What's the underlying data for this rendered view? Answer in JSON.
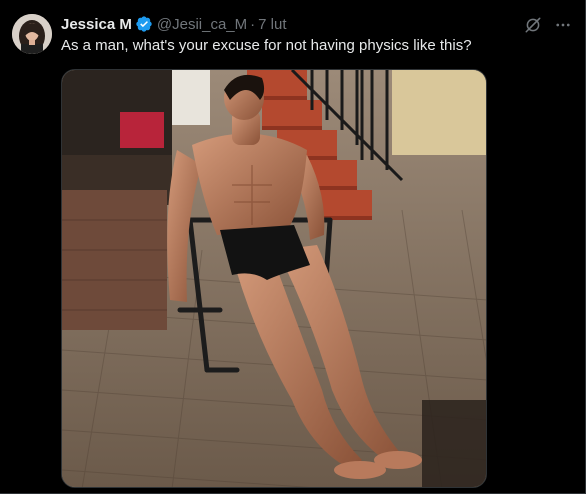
{
  "author": {
    "display_name": "Jessica M",
    "handle": "@Jesii_ca_M",
    "separator": "·",
    "timestamp": "7 lut",
    "verified": true,
    "verified_color": "#1d9bf0"
  },
  "tweet": {
    "text": "As a man, what's your excuse for not having physics like this?"
  },
  "media": {
    "alt": "Muscular man reclining shirtless in a metal patio chair on a brick-paved patio in the sun"
  },
  "icons": {
    "grok": "grok-icon",
    "more": "more-dots-icon",
    "verified": "verified-badge-icon"
  },
  "colors": {
    "background": "#000000",
    "text_primary": "#e7e9ea",
    "text_secondary": "#71767b",
    "border": "#2f3336"
  }
}
